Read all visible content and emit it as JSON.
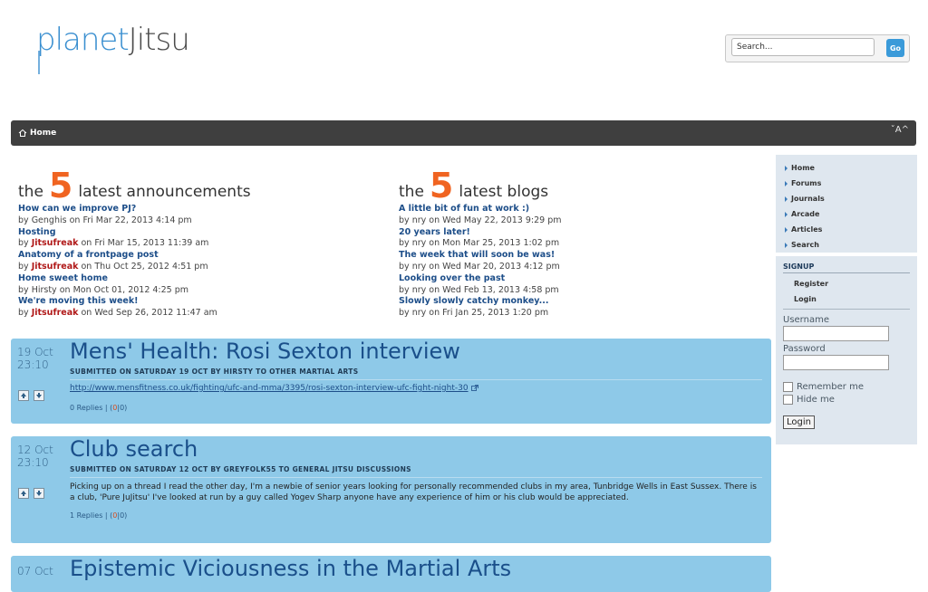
{
  "logo": {
    "part1": "planet",
    "part2": "Jitsu"
  },
  "search": {
    "placeholder": "Search...",
    "go_label": "Go"
  },
  "nav": {
    "home_label": "Home",
    "font_size_control": "ˇA^"
  },
  "announcements": {
    "prefix": "the",
    "number": "5",
    "suffix": "latest announcements",
    "items": [
      {
        "title": "How can we improve PJ?",
        "by": "by",
        "author": "Genghis",
        "on": "on Fri Mar 22, 2013 4:14 pm",
        "author_highlight": false
      },
      {
        "title": "Hosting",
        "by": "by",
        "author": "Jitsufreak",
        "on": "on Fri Mar 15, 2013 11:39 am",
        "author_highlight": true
      },
      {
        "title": "Anatomy of a frontpage post",
        "by": "by",
        "author": "Jitsufreak",
        "on": "on Thu Oct 25, 2012 4:51 pm",
        "author_highlight": true
      },
      {
        "title": "Home sweet home",
        "by": "by",
        "author": "Hirsty",
        "on": "on Mon Oct 01, 2012 4:25 pm",
        "author_highlight": false
      },
      {
        "title": "We're moving this week!",
        "by": "by",
        "author": "Jitsufreak",
        "on": "on Wed Sep 26, 2012 11:47 am",
        "author_highlight": true
      }
    ]
  },
  "blogs": {
    "prefix": "the",
    "number": "5",
    "suffix": "latest blogs",
    "items": [
      {
        "title": "A little bit of fun at work :)",
        "by": "by",
        "author": "nry",
        "on": "on Wed May 22, 2013 9:29 pm",
        "author_highlight": false
      },
      {
        "title": "20 years later!",
        "by": "by",
        "author": "nry",
        "on": "on Mon Mar 25, 2013 1:02 pm",
        "author_highlight": false
      },
      {
        "title": "The week that will soon be was!",
        "by": "by",
        "author": "nry",
        "on": "on Wed Mar 20, 2013 4:12 pm",
        "author_highlight": false
      },
      {
        "title": "Looking over the past",
        "by": "by",
        "author": "nry",
        "on": "on Wed Feb 13, 2013 4:58 pm",
        "author_highlight": false
      },
      {
        "title": "Slowly slowly catchy monkey...",
        "by": "by",
        "author": "nry",
        "on": "on Fri Jan 25, 2013 1:20 pm",
        "author_highlight": false
      }
    ]
  },
  "posts": [
    {
      "day": "19 Oct",
      "time": "23:10",
      "title": "Mens' Health: Rosi Sexton interview",
      "submitted": "SUBMITTED ON SATURDAY 19 OCT BY HIRSTY TO OTHER MARTIAL ARTS",
      "link": "http://www.mensfitness.co.uk/fighting/ufc-and-mma/3395/rosi-sexton-interview-ufc-fight-night-30",
      "body": "",
      "replies": "0 Replies",
      "sep": "|",
      "score_open": "(",
      "score_hot": "0",
      "score_rest": "|0)"
    },
    {
      "day": "12 Oct",
      "time": "23:10",
      "title": "Club search",
      "submitted": "SUBMITTED ON SATURDAY 12 OCT BY GREYFOLK55 TO GENERAL JITSU DISCUSSIONS",
      "link": "",
      "body": "Picking up on a thread I read the other day, I'm a newbie of senior years looking for personally recommended clubs in my area, Tunbridge Wells in East Sussex. There is a club, 'Pure JuJitsu' I've looked at run by a guy called Yogev Sharp anyone have any experience of him or his club would be appreciated.",
      "replies": "1 Replies",
      "sep": "|",
      "score_open": "(",
      "score_hot": "0",
      "score_rest": "|0)"
    },
    {
      "day": "07 Oct",
      "time": "",
      "title": "Epistemic Viciousness in the Martial Arts"
    }
  ],
  "sidebar": {
    "nav": [
      "Home",
      "Forums",
      "Journals",
      "Arcade",
      "Articles",
      "Search"
    ],
    "signup_heading": "SIGNUP",
    "signup_links": [
      "Register",
      "Login"
    ],
    "username_label": "Username",
    "password_label": "Password",
    "remember_label": "Remember me",
    "hide_label": "Hide me",
    "login_button": "Login"
  },
  "colors": {
    "accent_orange": "#f06421",
    "link_blue": "#1d4e89",
    "author_red": "#b01818",
    "post_bg": "#8ec9e8",
    "navbar_bg": "#3f3f3f"
  }
}
